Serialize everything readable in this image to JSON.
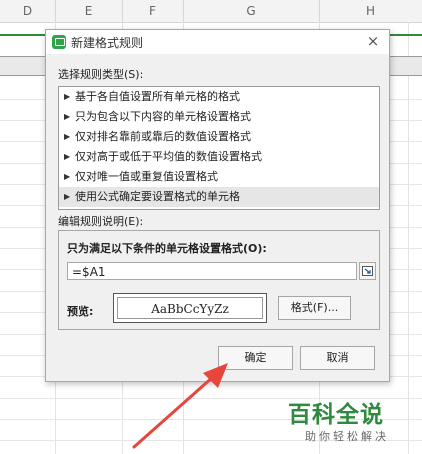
{
  "spreadsheet": {
    "columns": [
      "D",
      "E",
      "F",
      "G",
      "H"
    ]
  },
  "dialog": {
    "title": "新建格式规则",
    "close_glyph": "×",
    "rule_type_label": "选择规则类型(S):",
    "rule_types": [
      {
        "label": "基于各自值设置所有单元格的格式",
        "selected": false
      },
      {
        "label": "只为包含以下内容的单元格设置格式",
        "selected": false
      },
      {
        "label": "仅对排名靠前或靠后的数值设置格式",
        "selected": false
      },
      {
        "label": "仅对高于或低于平均值的数值设置格式",
        "selected": false
      },
      {
        "label": "仅对唯一值或重复值设置格式",
        "selected": false
      },
      {
        "label": "使用公式确定要设置格式的单元格",
        "selected": true
      }
    ],
    "edit_desc_label": "编辑规则说明(E):",
    "condition_label": "只为满足以下条件的单元格设置格式(O):",
    "formula_value": "=$A1",
    "preview_label": "预览:",
    "preview_text": "AaBbCcYyZz",
    "format_button": "格式(F)...",
    "ok_button": "确定",
    "cancel_button": "取消"
  },
  "watermark": {
    "title": "百科全说",
    "subtitle": "助你轻松解决"
  },
  "colors": {
    "accent_green": "#2e8b3a",
    "annotation_red": "#e8453c",
    "watermark_green": "#2f8a3f"
  },
  "icons": {
    "app": "wps-spreadsheet-icon",
    "close": "close-icon",
    "expand": "triangle-right-icon",
    "range_select": "range-select-icon"
  }
}
